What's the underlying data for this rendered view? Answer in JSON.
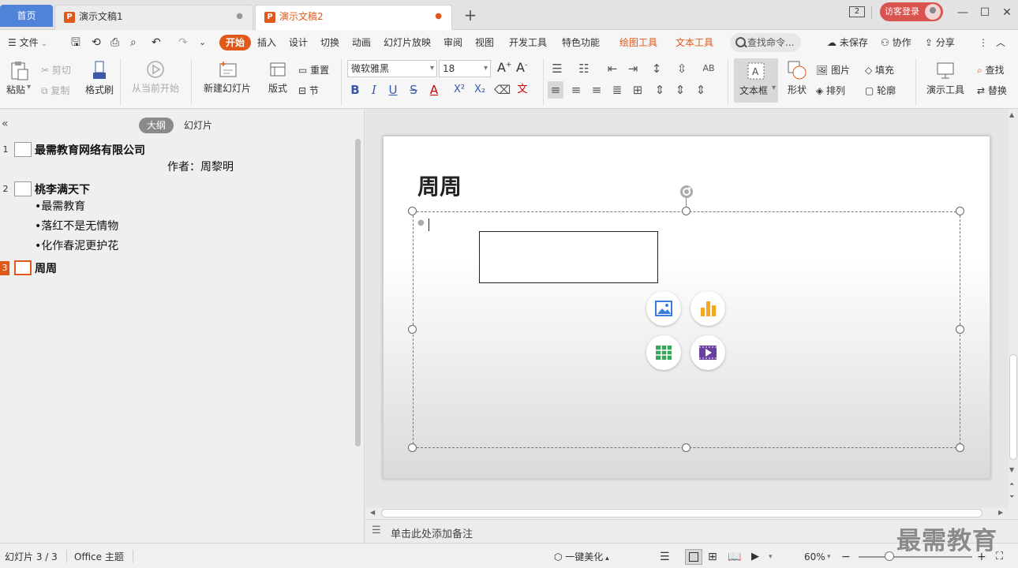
{
  "tabs": {
    "home": "首页",
    "docs": [
      {
        "label": "演示文稿1",
        "active": false
      },
      {
        "label": "演示文稿2",
        "active": true
      }
    ],
    "new_tab": "+",
    "window_count": "2",
    "login": "访客登录"
  },
  "menu": {
    "file": "文件",
    "items": [
      "开始",
      "插入",
      "设计",
      "切换",
      "动画",
      "幻灯片放映",
      "审阅",
      "视图",
      "开发工具",
      "特色功能"
    ],
    "context_items": [
      "绘图工具",
      "文本工具"
    ],
    "search": "查找命令...",
    "unsaved": "未保存",
    "collab": "协作",
    "share": "分享"
  },
  "ribbon": {
    "paste": "粘贴",
    "cut": "剪切",
    "copy": "复制",
    "format_painter": "格式刷",
    "from_current": "从当前开始",
    "new_slide": "新建幻灯片",
    "layout": "版式",
    "reset": "重置",
    "section": "节",
    "font_name": "微软雅黑",
    "font_size": "18",
    "text_box": "文本框",
    "shape": "形状",
    "picture": "图片",
    "fill": "填充",
    "arrange": "排列",
    "outline": "轮廓",
    "presentation_tools": "演示工具",
    "find": "查找",
    "replace": "替换"
  },
  "left_panel": {
    "tab_outline": "大纲",
    "tab_slides": "幻灯片",
    "slides": [
      {
        "num": "1",
        "title": "最需教育网络有限公司",
        "lines": [
          "作者：周黎明"
        ]
      },
      {
        "num": "2",
        "title": "桃李满天下",
        "lines": [
          "•最需教育",
          "•落红不是无情物",
          "•化作春泥更护花"
        ]
      },
      {
        "num": "3",
        "title": "周周",
        "lines": []
      }
    ]
  },
  "slide": {
    "title": "周周"
  },
  "notes": {
    "placeholder": "单击此处添加备注"
  },
  "status": {
    "slide_info": "幻灯片 3 / 3",
    "theme": "Office 主题",
    "beautify": "一键美化",
    "zoom": "60%"
  },
  "watermark": "最需教育",
  "colors": {
    "accent": "#e0591b",
    "home_tab": "#4f83d8",
    "login": "#d9534f"
  }
}
